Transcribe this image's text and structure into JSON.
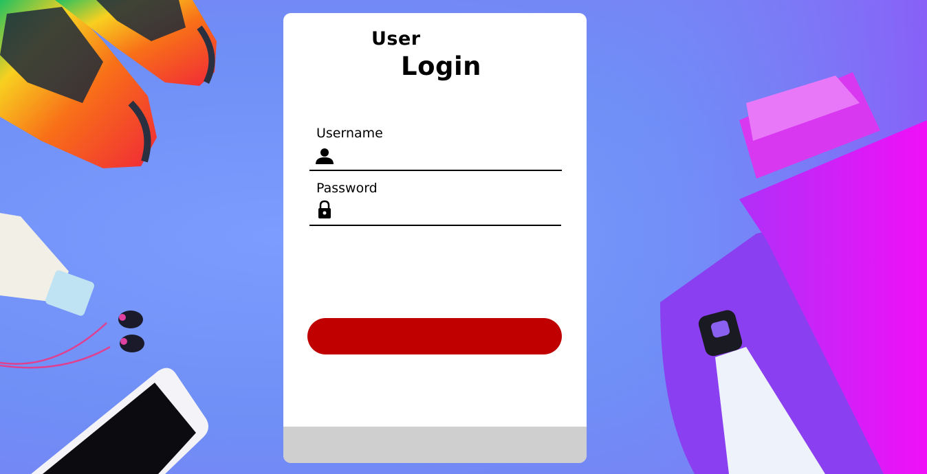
{
  "login_card": {
    "title_user": "User",
    "title_login": "Login",
    "username": {
      "label": "Username",
      "value": "",
      "placeholder": "",
      "icon": "user-icon"
    },
    "password": {
      "label": "Password",
      "value": "",
      "placeholder": "",
      "icon": "lock-icon"
    },
    "submit_label": "",
    "footer_text": ""
  },
  "colors": {
    "background": "#7090f8",
    "card": "#ffffff",
    "button": "#c00000",
    "footer": "#d0cfd0",
    "mat": "#e020f0",
    "shoe": "#f03030"
  }
}
